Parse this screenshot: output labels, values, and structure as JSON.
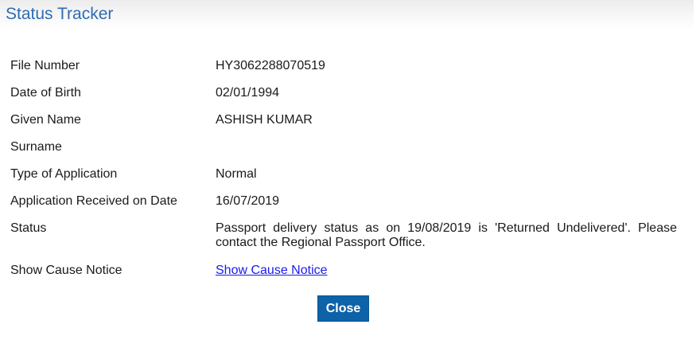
{
  "header": {
    "title": "Status Tracker"
  },
  "details": [
    {
      "label": "File Number",
      "value": "HY3062288070519"
    },
    {
      "label": "Date of Birth",
      "value": "02/01/1994"
    },
    {
      "label": "Given Name",
      "value": "ASHISH KUMAR"
    },
    {
      "label": "Surname",
      "value": ""
    },
    {
      "label": "Type of Application",
      "value": "Normal"
    },
    {
      "label": "Application Received on Date",
      "value": "16/07/2019"
    },
    {
      "label": "Status",
      "value": "Passport delivery status as on 19/08/2019 is 'Returned Undelivered'. Please contact the Regional Passport Office."
    },
    {
      "label": "Show Cause Notice",
      "value": "Show Cause Notice"
    }
  ],
  "actions": {
    "close_label": "Close"
  },
  "colors": {
    "title": "#2d6db2",
    "button": "#0d62a8",
    "link": "#1a1aee"
  }
}
